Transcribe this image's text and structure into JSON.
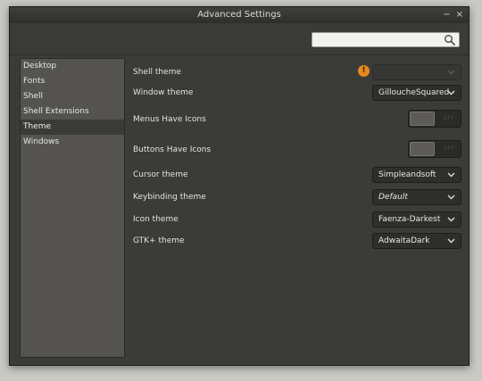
{
  "window": {
    "title": "Advanced Settings",
    "minimize_glyph": "−",
    "close_glyph": "×"
  },
  "search": {
    "value": "",
    "placeholder": ""
  },
  "sidebar": {
    "items": [
      {
        "label": "Desktop",
        "selected": false
      },
      {
        "label": "Fonts",
        "selected": false
      },
      {
        "label": "Shell",
        "selected": false
      },
      {
        "label": "Shell Extensions",
        "selected": false
      },
      {
        "label": "Theme",
        "selected": true
      },
      {
        "label": "Windows",
        "selected": false
      }
    ]
  },
  "settings": {
    "shell_theme": {
      "label": "Shell theme",
      "value": "",
      "warning_glyph": "!"
    },
    "window_theme": {
      "label": "Window theme",
      "value": "GilloucheSquared"
    },
    "menus_have_icons": {
      "label": "Menus Have Icons",
      "state": "OFF"
    },
    "buttons_have_icons": {
      "label": "Buttons Have Icons",
      "state": "OFF"
    },
    "cursor_theme": {
      "label": "Cursor theme",
      "value": "Simpleandsoft"
    },
    "keybinding_theme": {
      "label": "Keybinding theme",
      "value": "Default"
    },
    "icon_theme": {
      "label": "Icon theme",
      "value": "Faenza-Darkest"
    },
    "gtk_theme": {
      "label": "GTK+ theme",
      "value": "AdwaitaDark"
    }
  },
  "colors": {
    "window_bg": "#3b3b38",
    "sidebar_bg": "#54534f",
    "warning": "#e58a1c"
  }
}
